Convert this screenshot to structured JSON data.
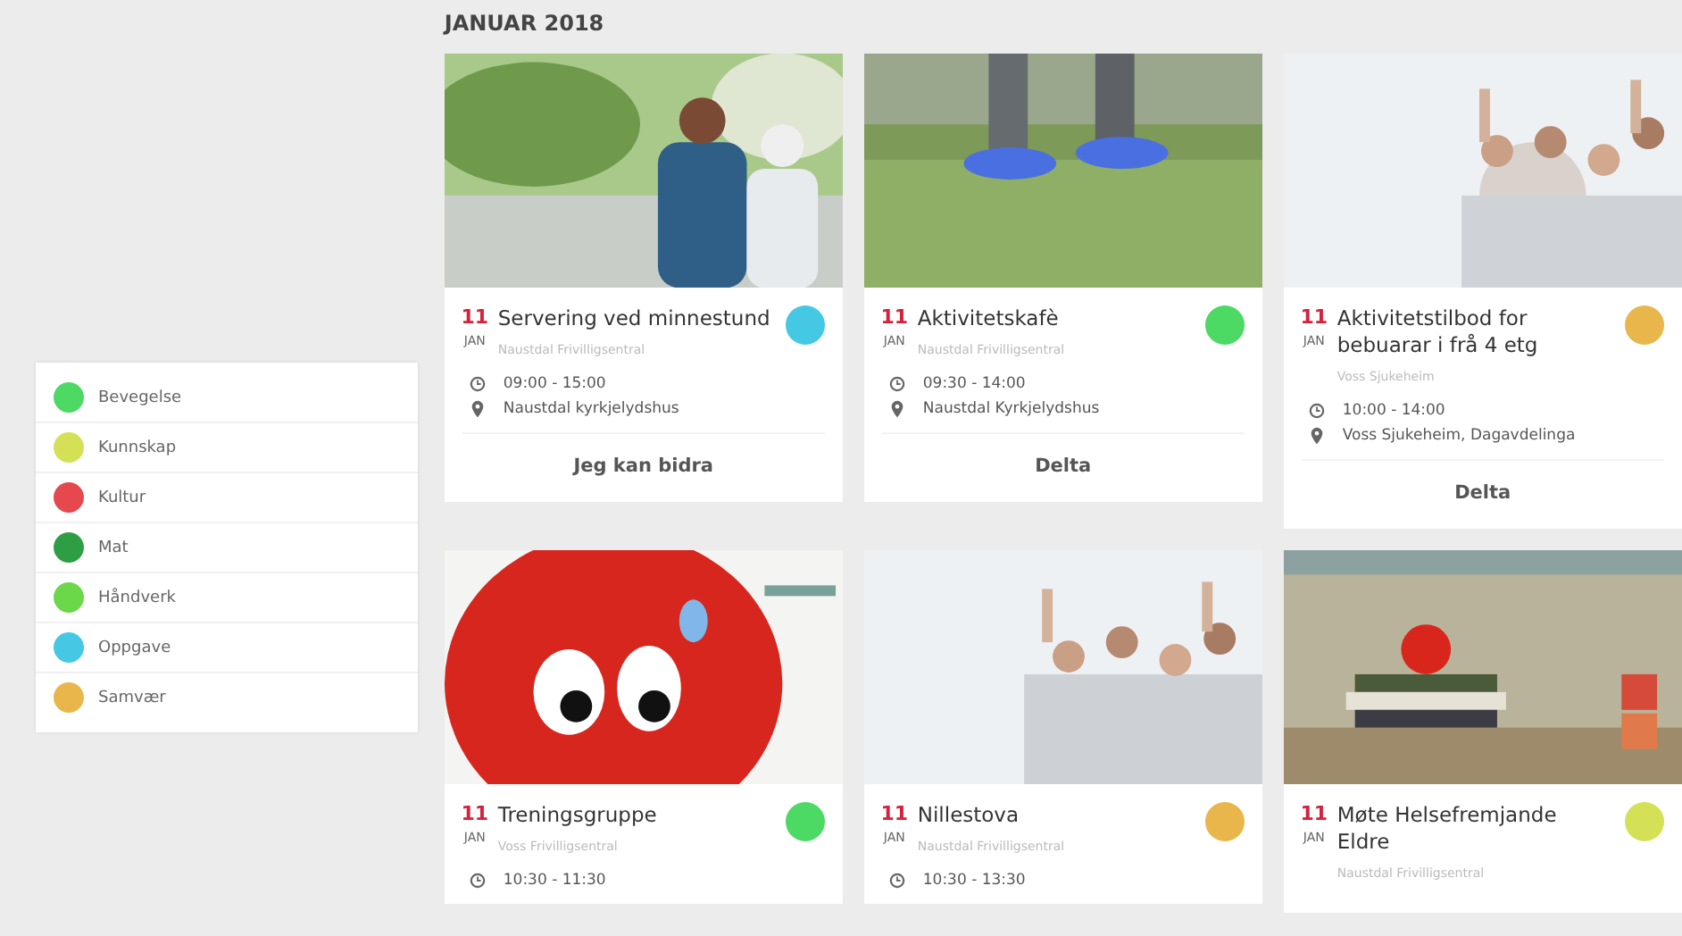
{
  "heading": "JANUAR 2018",
  "categories": [
    {
      "name": "Bevegelse",
      "color": "#4cd964"
    },
    {
      "name": "Kunnskap",
      "color": "#d4e157"
    },
    {
      "name": "Kultur",
      "color": "#e5484d"
    },
    {
      "name": "Mat",
      "color": "#2e9e44"
    },
    {
      "name": "Håndverk",
      "color": "#6bd84a"
    },
    {
      "name": "Oppgave",
      "color": "#45c8e4"
    },
    {
      "name": "Samvær",
      "color": "#e8b64a"
    }
  ],
  "events": [
    {
      "day": "11",
      "month": "JAN",
      "title": "Servering ved minnestund",
      "color": "#45c8e4",
      "organizer": "Naustdal Frivilligsentral",
      "time": "09:00 - 15:00",
      "place": "Naustdal kyrkjelydshus",
      "action": "Jeg kan bidra"
    },
    {
      "day": "11",
      "month": "JAN",
      "title": "Aktivitetskafè",
      "color": "#4cd964",
      "organizer": "Naustdal Frivilligsentral",
      "time": "09:30 - 14:00",
      "place": "Naustdal Kyrkjelydshus",
      "action": "Delta"
    },
    {
      "day": "11",
      "month": "JAN",
      "title": "Aktivitetstilbod for bebuarar i frå 4 etg",
      "color": "#e8b64a",
      "organizer": "Voss Sjukeheim",
      "time": "10:00 - 14:00",
      "place": "Voss Sjukeheim, Dagavdelinga",
      "action": "Delta"
    },
    {
      "day": "11",
      "month": "JAN",
      "title": "Treningsgruppe",
      "color": "#4cd964",
      "organizer": "Voss Frivilligsentral",
      "time": "10:30 - 11:30"
    },
    {
      "day": "11",
      "month": "JAN",
      "title": "Nillestova",
      "color": "#e8b64a",
      "organizer": "Naustdal Frivilligsentral",
      "time": "10:30 - 13:30"
    },
    {
      "day": "11",
      "month": "JAN",
      "title": "Møte Helsefremjande Eldre",
      "color": "#d4e157",
      "organizer": "Naustdal Frivilligsentral"
    }
  ]
}
